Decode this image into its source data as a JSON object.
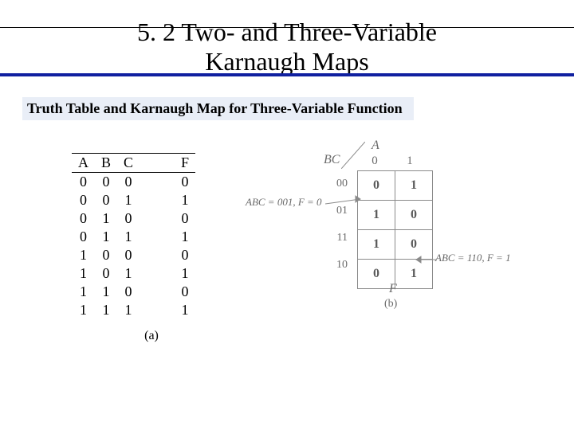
{
  "title_line1": "5. 2 Two- and Three-Variable",
  "title_line2": "Karnaugh Maps",
  "subtitle": "Truth Table and Karnaugh Map for Three-Variable Function",
  "truth_table": {
    "headers": {
      "A": "A",
      "B": "B",
      "C": "C",
      "F": "F"
    },
    "rows": [
      {
        "A": "0",
        "B": "0",
        "C": "0",
        "F": "0"
      },
      {
        "A": "0",
        "B": "0",
        "C": "1",
        "F": "1"
      },
      {
        "A": "0",
        "B": "1",
        "C": "0",
        "F": "0"
      },
      {
        "A": "0",
        "B": "1",
        "C": "1",
        "F": "1"
      },
      {
        "A": "1",
        "B": "0",
        "C": "0",
        "F": "0"
      },
      {
        "A": "1",
        "B": "0",
        "C": "1",
        "F": "1"
      },
      {
        "A": "1",
        "B": "1",
        "C": "0",
        "F": "0"
      },
      {
        "A": "1",
        "B": "1",
        "C": "1",
        "F": "1"
      }
    ],
    "caption": "(a)"
  },
  "kmap": {
    "var_top": "A",
    "var_side": "BC",
    "col_labels": [
      "0",
      "1"
    ],
    "row_labels": [
      "00",
      "01",
      "11",
      "10"
    ],
    "cells": [
      [
        "0",
        "1"
      ],
      [
        "1",
        "0"
      ],
      [
        "1",
        "0"
      ],
      [
        "0",
        "1"
      ]
    ],
    "output_label": "F",
    "caption": "(b)",
    "annot_left": "ABC = 001, F = 0",
    "annot_right": "ABC = 110, F = 1"
  },
  "chart_data": {
    "type": "table",
    "title": "Three-Variable Karnaugh Map",
    "columns_variable": "A",
    "rows_variable": "BC",
    "column_headers": [
      "0",
      "1"
    ],
    "row_headers": [
      "00",
      "01",
      "11",
      "10"
    ],
    "values": [
      [
        0,
        1
      ],
      [
        1,
        0
      ],
      [
        1,
        0
      ],
      [
        0,
        1
      ]
    ]
  }
}
